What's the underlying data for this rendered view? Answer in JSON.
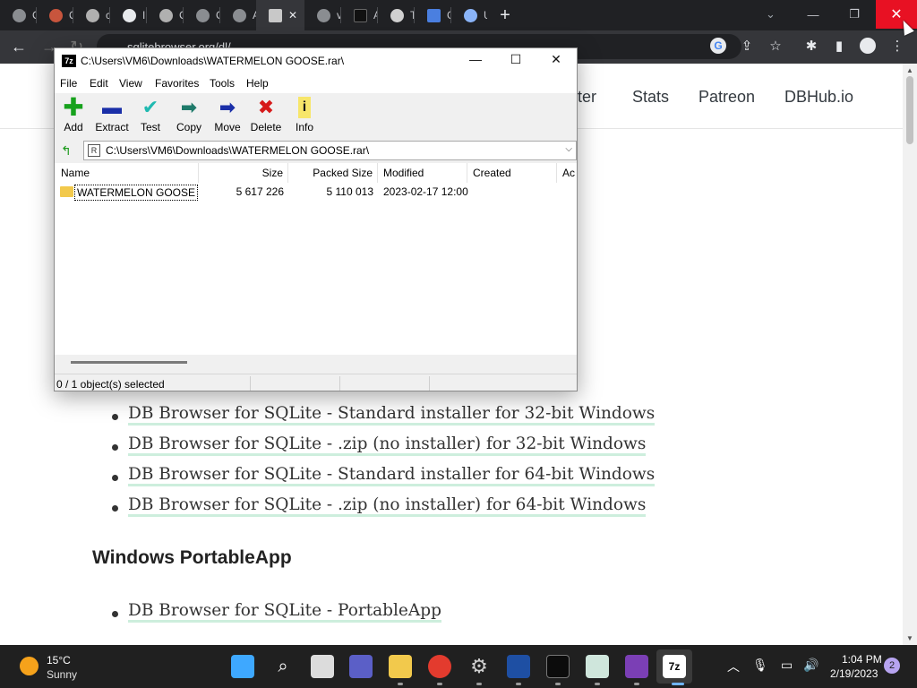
{
  "browser": {
    "tabs": [
      {
        "title": "Cor"
      },
      {
        "title": "QEI"
      },
      {
        "title": "con"
      },
      {
        "title": "Inv"
      },
      {
        "title": "Col"
      },
      {
        "title": "Col"
      },
      {
        "title": "Adi"
      },
      {
        "title": ""
      },
      {
        "title": "vm"
      },
      {
        "title": "AI V"
      },
      {
        "title": "Tua"
      },
      {
        "title": "Go"
      },
      {
        "title": "Ufi"
      }
    ],
    "url": "sqlitebrowser.org/dl/",
    "window_close_color": "#e81123"
  },
  "page": {
    "nav": [
      "tter",
      "Stats",
      "Patreon",
      "DBHub.io"
    ],
    "windows_links": [
      "DB Browser for SQLite - Standard installer for 32-bit Windows",
      "DB Browser for SQLite - .zip (no installer) for 32-bit Windows",
      "DB Browser for SQLite - Standard installer for 64-bit Windows",
      "DB Browser for SQLite - .zip (no installer) for 64-bit Windows"
    ],
    "portable_heading": "Windows PortableApp",
    "portable_links": [
      "DB Browser for SQLite - PortableApp"
    ]
  },
  "zip": {
    "title": "C:\\Users\\VM6\\Downloads\\WATERMELON GOOSE.rar\\",
    "logo": "7z",
    "menu": [
      "File",
      "Edit",
      "View",
      "Favorites",
      "Tools",
      "Help"
    ],
    "toolbar": [
      {
        "label": "Add",
        "icon": "plus-icon",
        "glyph": "✚"
      },
      {
        "label": "Extract",
        "icon": "minus-icon",
        "glyph": "▬"
      },
      {
        "label": "Test",
        "icon": "check-icon",
        "glyph": "✔"
      },
      {
        "label": "Copy",
        "icon": "copy-arrow-icon",
        "glyph": "➡"
      },
      {
        "label": "Move",
        "icon": "move-arrow-icon",
        "glyph": "➡"
      },
      {
        "label": "Delete",
        "icon": "delete-x-icon",
        "glyph": "✖"
      },
      {
        "label": "Info",
        "icon": "info-icon",
        "glyph": "i"
      }
    ],
    "address": "C:\\Users\\VM6\\Downloads\\WATERMELON GOOSE.rar\\",
    "columns": [
      "Name",
      "Size",
      "Packed Size",
      "Modified",
      "Created",
      "Ac"
    ],
    "rows": [
      {
        "name": "WATERMELON GOOSE",
        "size": "5 617 226",
        "packed": "5 110 013",
        "modified": "2023-02-17 12:00"
      }
    ],
    "status": "0 / 1 object(s) selected"
  },
  "taskbar": {
    "temperature": "15°C",
    "condition": "Sunny",
    "seven_zip_label": "7z",
    "time": "1:04 PM",
    "date": "2/19/2023",
    "notifications": "2"
  }
}
